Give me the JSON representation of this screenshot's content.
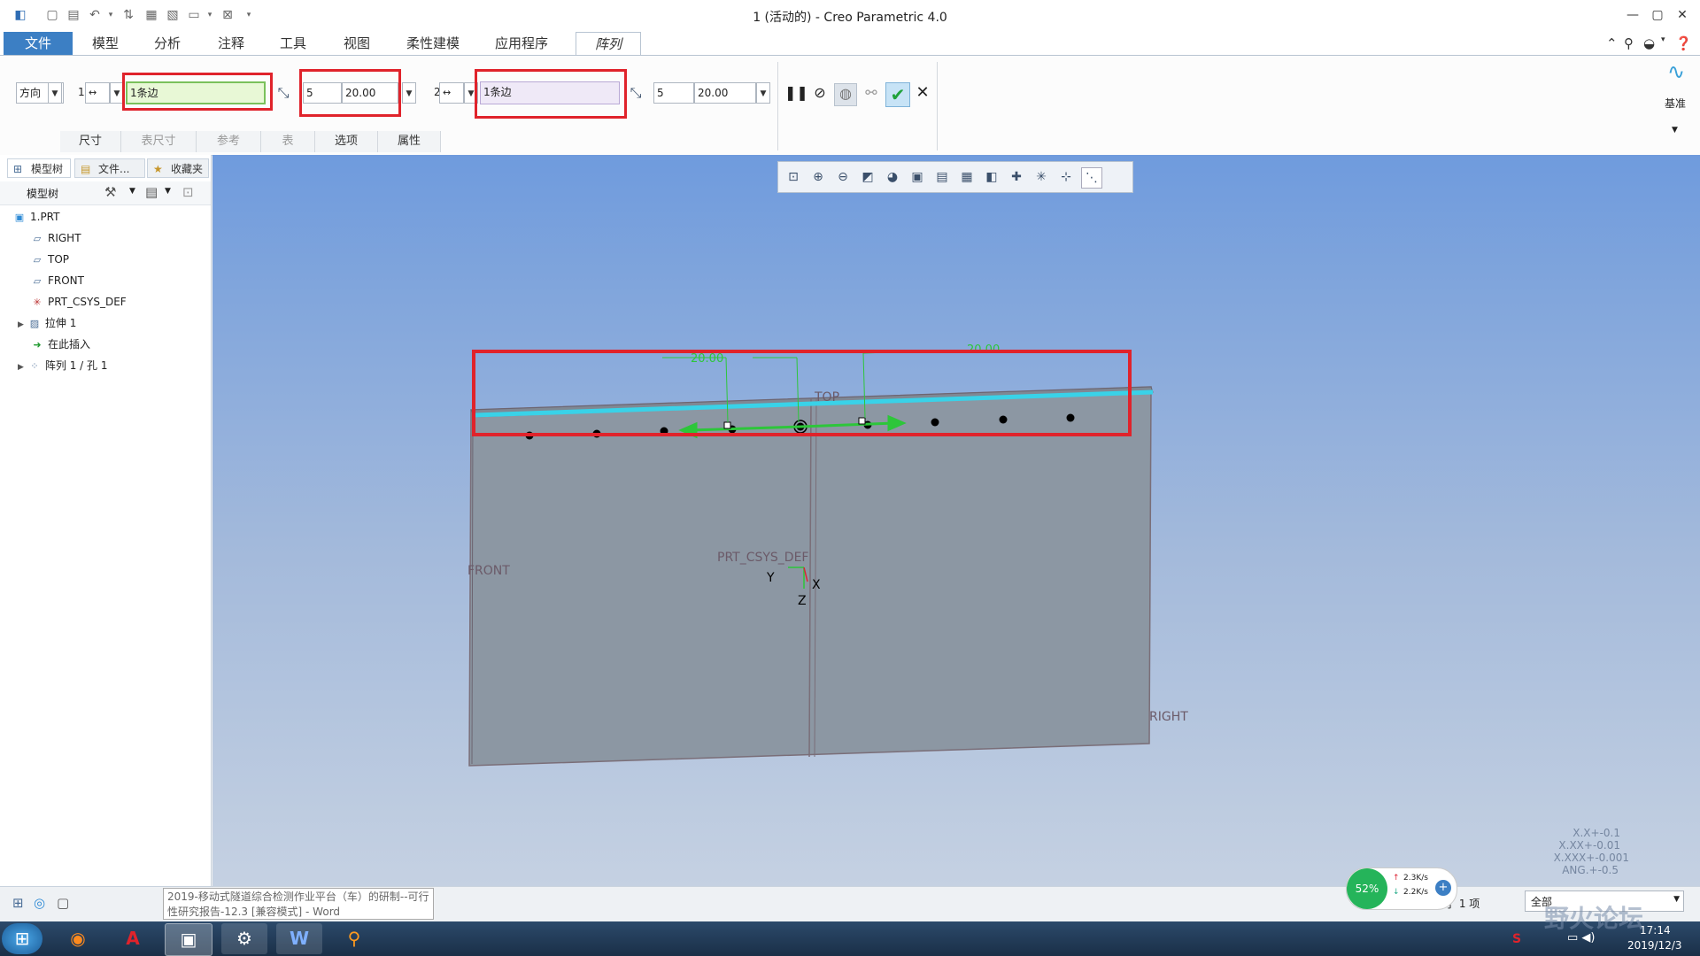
{
  "window": {
    "title": "1 (活动的) - Creo Parametric 4.0",
    "controls": [
      "—",
      "▢",
      "✕"
    ]
  },
  "quick_access": [
    "▢",
    "↶",
    "▾",
    "▤",
    "▦",
    "▾",
    "⊠",
    "▾"
  ],
  "tabs": [
    {
      "label": "文件"
    },
    {
      "label": "模型"
    },
    {
      "label": "分析"
    },
    {
      "label": "注释"
    },
    {
      "label": "工具"
    },
    {
      "label": "视图"
    },
    {
      "label": "柔性建模"
    },
    {
      "label": "应用程序"
    },
    {
      "label": "阵列"
    }
  ],
  "ribbon": {
    "pattern_type": "方向",
    "dir1_num": "1",
    "dir1_ref": "1条边",
    "dir1_count": "5",
    "dir1_spacing": "20.00",
    "dir2_num": "2",
    "dir2_ref": "1条边",
    "dir2_count": "5",
    "dir2_spacing": "20.00",
    "datum_label": "基准",
    "subtabs": [
      {
        "label": "尺寸",
        "enabled": true
      },
      {
        "label": "表尺寸",
        "enabled": false
      },
      {
        "label": "参考",
        "enabled": false
      },
      {
        "label": "表",
        "enabled": false
      },
      {
        "label": "选项",
        "enabled": true
      },
      {
        "label": "属性",
        "enabled": true
      }
    ]
  },
  "left_panel": {
    "tabs": [
      "模型树",
      "文件...",
      "收藏夹"
    ],
    "tree_header": "模型树",
    "tree": [
      {
        "label": "1.PRT",
        "icon": "part-icon",
        "glyph": "▣"
      },
      {
        "label": "RIGHT",
        "icon": "datum-plane-icon",
        "glyph": "▱"
      },
      {
        "label": "TOP",
        "icon": "datum-plane-icon",
        "glyph": "▱"
      },
      {
        "label": "FRONT",
        "icon": "datum-plane-icon",
        "glyph": "▱"
      },
      {
        "label": "PRT_CSYS_DEF",
        "icon": "csys-icon",
        "glyph": "✳"
      },
      {
        "label": "拉伸 1",
        "icon": "extrude-icon",
        "glyph": "▨"
      },
      {
        "label": "在此插入",
        "icon": "insert-here-icon",
        "glyph": "➜"
      },
      {
        "label": "阵列 1 / 孔 1",
        "icon": "pattern-icon",
        "glyph": "⁘"
      }
    ]
  },
  "viewport": {
    "labels": {
      "front": "FRONT",
      "right": "RIGHT",
      "top": "TOP",
      "csys": "PRT_CSYS_DEF",
      "axis_x": "X",
      "axis_y": "Y",
      "axis_z": "Z",
      "dim1": "20.00",
      "dim2": "20.00"
    },
    "tolerances": [
      "X.X+-0.1",
      "X.XX+-0.01",
      "X.XXX+-0.001",
      "ANG.+-0.5"
    ]
  },
  "status": {
    "selected": "选择了 1 项",
    "filter": "全部",
    "tooltip_line1": "2019-移动式隧道综合检测作业平台（车）的研制--可行",
    "tooltip_line2": "性研究报告-12.3 [兼容模式] - Word",
    "net_percent": "52%",
    "net_up": "2.3K/s",
    "net_down": "2.2K/s"
  },
  "taskbar": {
    "time": "17:14",
    "date": "2019/12/3",
    "watermark": "野火论坛"
  },
  "colors": {
    "accent": "#3c7fc4",
    "highlight_red": "#e0232b",
    "model_face": "#8c97a3",
    "edge_cyan": "#39d2e8",
    "dim_green": "#2dc63a"
  }
}
